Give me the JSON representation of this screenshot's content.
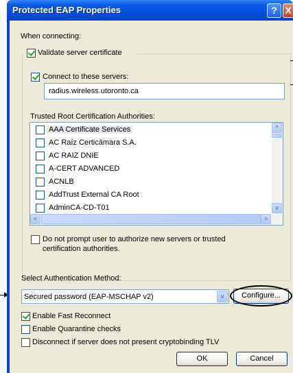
{
  "window": {
    "title": "Protected EAP Properties",
    "help_glyph": "?",
    "close_glyph": "X"
  },
  "connecting": {
    "heading": "When connecting:",
    "validate_label": "Validate server certificate",
    "validate_checked": true,
    "connect_label": "Connect to these servers:",
    "connect_checked": true,
    "servers_value": "radius.wireless.utoronto.ca"
  },
  "trusted": {
    "heading": "Trusted Root Certification Authorities:",
    "items": [
      {
        "label": "AAA Certificate Services",
        "checked": false,
        "selected": true
      },
      {
        "label": "AC Raíz Certicámara S.A.",
        "checked": false
      },
      {
        "label": "AC RAIZ DNIE",
        "checked": false
      },
      {
        "label": "A-CERT ADVANCED",
        "checked": false
      },
      {
        "label": "ACNLB",
        "checked": false
      },
      {
        "label": "AddTrust External CA Root",
        "checked": false
      },
      {
        "label": "AdminCA-CD-T01",
        "checked": false
      }
    ],
    "scroll_up_glyph": "^",
    "scroll_down_glyph": "v",
    "scroll_left_glyph": "<",
    "scroll_right_glyph": ">"
  },
  "no_prompt": {
    "label_line1": "Do not prompt user to authorize new servers or trusted",
    "label_line2": "certification authorities.",
    "checked": false
  },
  "auth": {
    "heading": "Select Authentication Method:",
    "selected_value": "Secured password (EAP-MSCHAP v2)",
    "configure_label": "Configure..."
  },
  "options": [
    {
      "label": "Enable Fast Reconnect",
      "checked": true
    },
    {
      "label": "Enable Quarantine checks",
      "checked": false
    },
    {
      "label": "Disconnect if server does not present cryptobinding TLV",
      "checked": false
    }
  ],
  "buttons": {
    "ok_label": "OK",
    "cancel_label": "Cancel"
  }
}
